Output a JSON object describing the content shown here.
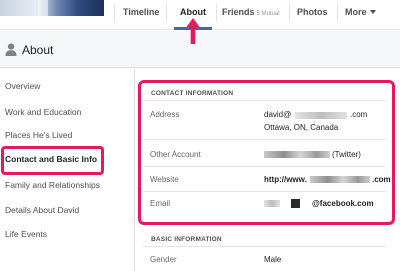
{
  "tabs": {
    "timeline": "Timeline",
    "about": "About",
    "friends": "Friends",
    "friends_mutual": "5 Mutual",
    "photos": "Photos",
    "more": "More"
  },
  "header": {
    "title": "About"
  },
  "sidebar": {
    "items": [
      {
        "label": "Overview"
      },
      {
        "label": "Work and Education"
      },
      {
        "label": "Places He's Lived"
      },
      {
        "label": "Contact and Basic Info",
        "active": true
      },
      {
        "label": "Family and Relationships"
      },
      {
        "label": "Details About David"
      },
      {
        "label": "Life Events"
      }
    ]
  },
  "contact": {
    "section_title": "CONTACT INFORMATION",
    "address_label": "Address",
    "email_prefix": "david@",
    "email_suffix": ".com",
    "city": "Ottawa, ON, Canada",
    "other_account_label": "Other Account",
    "other_account_service": "(Twitter)",
    "website_label": "Website",
    "website_prefix": "http://www.",
    "website_suffix": ".com",
    "email_label": "Email",
    "email_domain": "@facebook.com"
  },
  "basic": {
    "section_title": "BASIC INFORMATION",
    "gender_label": "Gender",
    "gender_value": "Male"
  },
  "colors": {
    "highlight": "#e8185e",
    "tab_active": "#4267b2"
  },
  "icons": [
    "person-icon",
    "chevron-down-icon",
    "arrow-up-icon"
  ]
}
